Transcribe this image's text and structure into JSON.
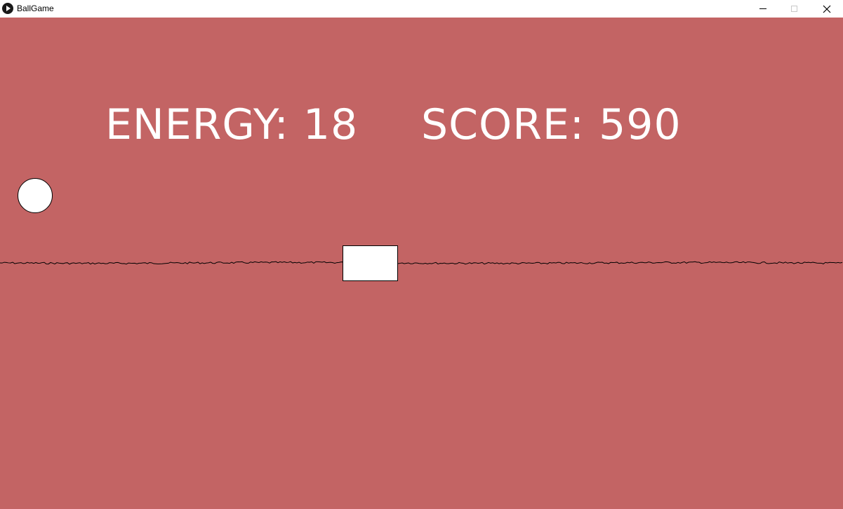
{
  "window": {
    "title": "BallGame",
    "icon": "play-icon"
  },
  "hud": {
    "energy_text": "ENERGY: 18",
    "score_text": "SCORE: 590",
    "energy": 18,
    "score": 590
  },
  "colors": {
    "background": "#c36464",
    "text": "#ffffff",
    "ball": "#ffffff",
    "block": "#ffffff",
    "ground_line": "#000000"
  }
}
